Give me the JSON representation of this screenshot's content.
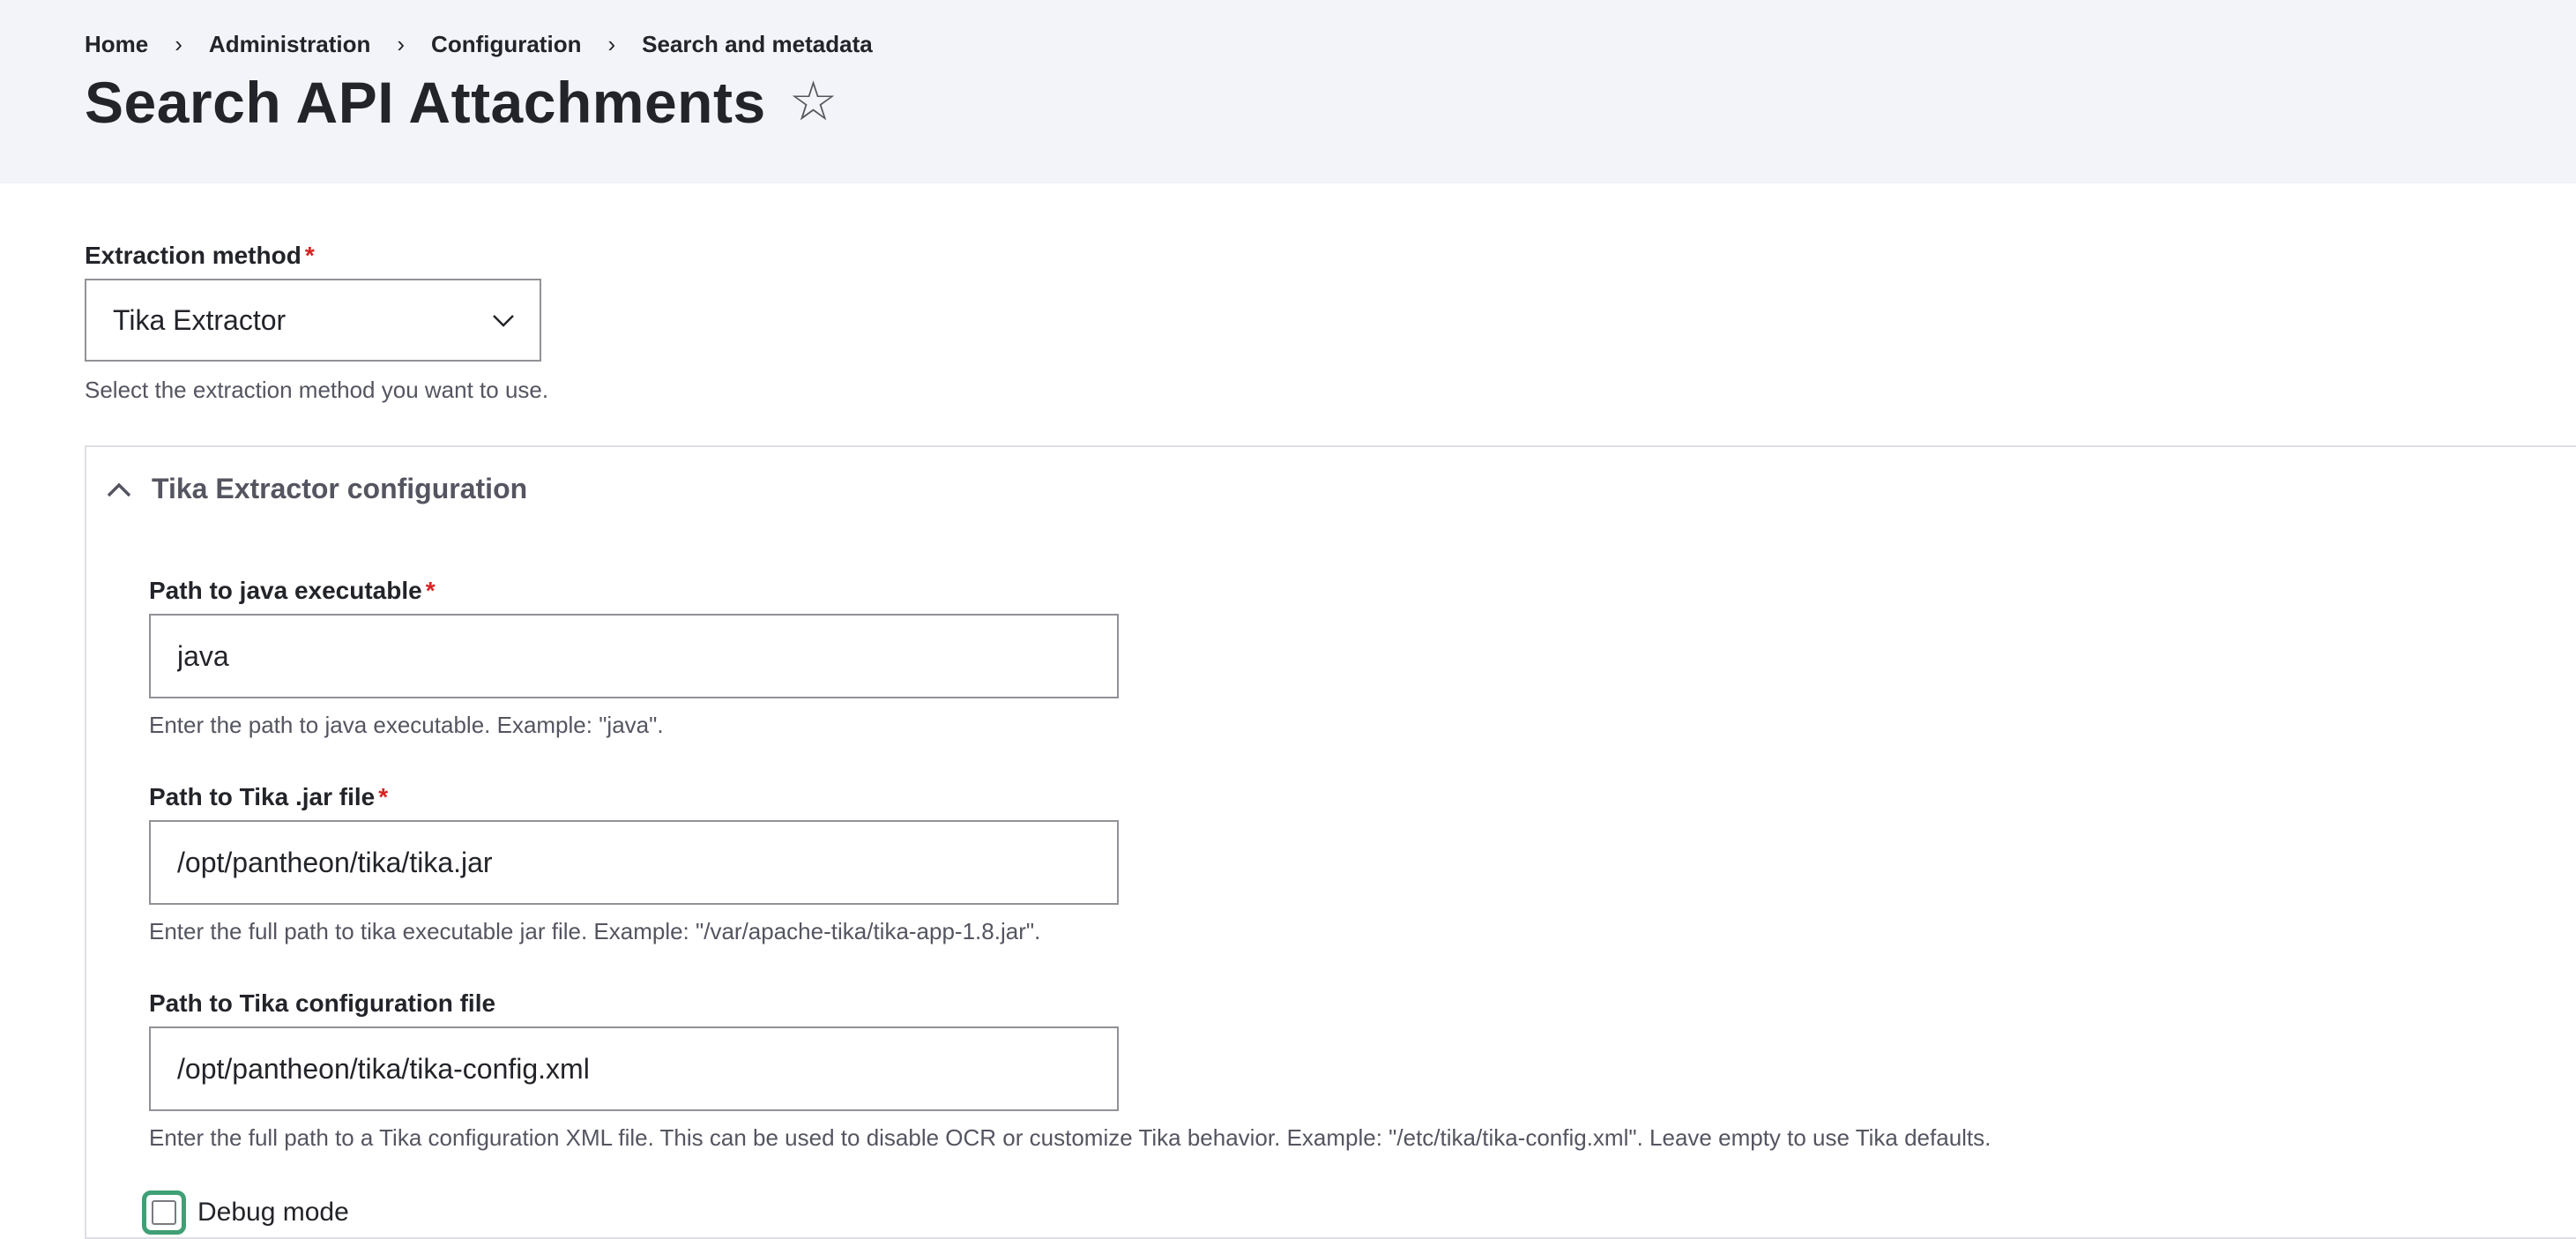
{
  "breadcrumb": {
    "items": [
      "Home",
      "Administration",
      "Configuration",
      "Search and metadata"
    ],
    "separator": "›"
  },
  "page": {
    "title": "Search API Attachments",
    "star_icon": "☆"
  },
  "extraction_method": {
    "label": "Extraction method",
    "required_mark": "*",
    "value": "Tika Extractor",
    "description": "Select the extraction method you want to use."
  },
  "tika_config": {
    "summary": "Tika Extractor configuration",
    "java_path": {
      "label": "Path to java executable",
      "required_mark": "*",
      "value": "java",
      "description": "Enter the path to java executable. Example: \"java\"."
    },
    "jar_path": {
      "label": "Path to Tika .jar file",
      "required_mark": "*",
      "value": "/opt/pantheon/tika/tika.jar",
      "description": "Enter the full path to tika executable jar file. Example: \"/var/apache-tika/tika-app-1.8.jar\"."
    },
    "config_path": {
      "label": "Path to Tika configuration file",
      "value": "/opt/pantheon/tika/tika-config.xml",
      "description": "Enter the full path to a Tika configuration XML file. This can be used to disable OCR or customize Tika behavior. Example: \"/etc/tika/tika-config.xml\". Leave empty to use Tika defaults."
    },
    "debug": {
      "label": "Debug mode"
    }
  },
  "colors": {
    "header_bg": "#f3f4f9",
    "required": "#d72222",
    "focus_ring": "#3fa075"
  }
}
